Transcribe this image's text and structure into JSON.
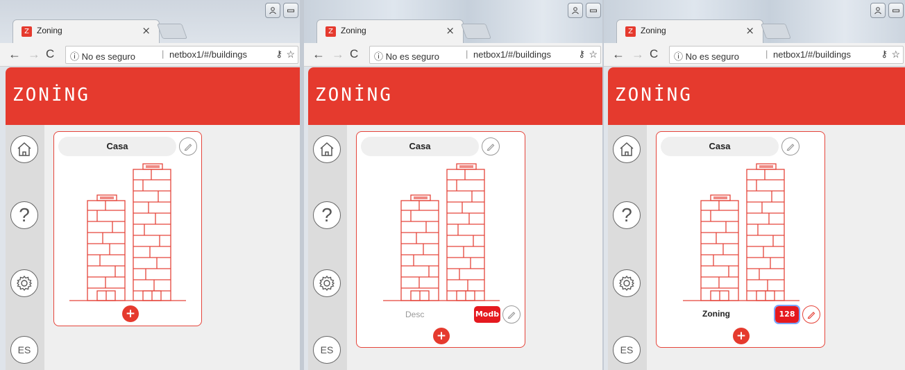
{
  "browser": {
    "tab_title": "Zoning",
    "tab_close": "×",
    "favicon_letter": "Z",
    "back": "←",
    "forward": "→",
    "reload": "C",
    "security_text": "ⓘ No es seguro",
    "separator": "|",
    "url": "netbox1/#/buildings",
    "key_icon": "⚷",
    "star_icon": "☆",
    "window_user_icon": "person-icon",
    "window_minimize_icon": "minimize-icon"
  },
  "app": {
    "logo": "ZONİNG",
    "brand_color": "#e53a2e"
  },
  "sidebar": {
    "home_icon": "home-icon",
    "help_label": "?",
    "settings_icon": "gear-icon",
    "lang_label": "ES"
  },
  "panels": [
    {
      "card": {
        "name": "Casa",
        "edit_icon": "pencil-icon",
        "add_label": "+"
      }
    },
    {
      "card": {
        "name": "Casa",
        "desc_placeholder": "Desc",
        "badge_value": "Modb",
        "edit_icon": "pencil-icon",
        "add_label": "+"
      }
    },
    {
      "card": {
        "name": "Casa",
        "desc_value": "Zoning",
        "badge_value": "128",
        "edit_icon": "pencil-icon",
        "add_label": "+"
      }
    }
  ]
}
